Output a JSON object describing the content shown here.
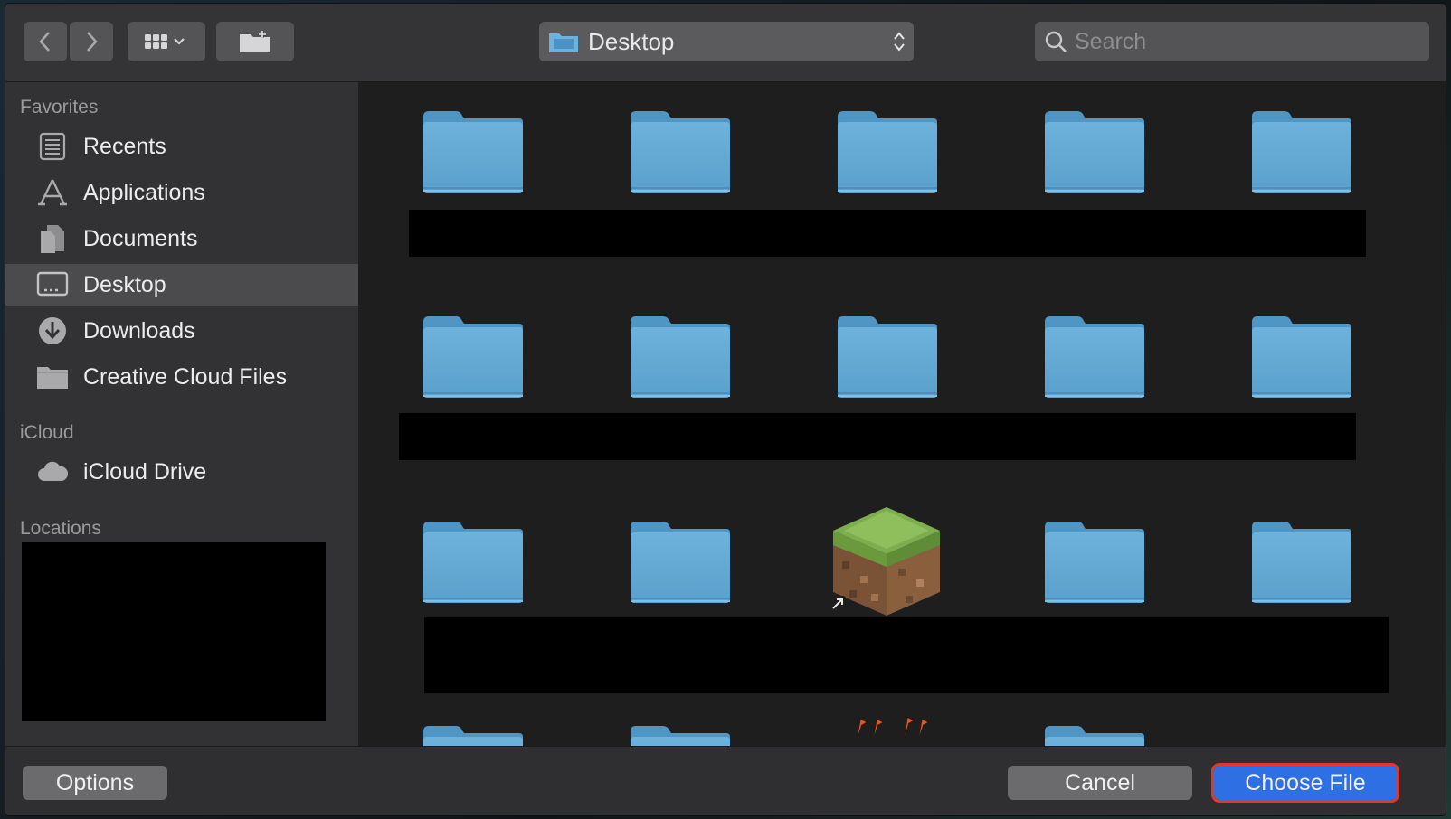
{
  "toolbar": {
    "path_label": "Desktop",
    "search_placeholder": "Search"
  },
  "sidebar": {
    "favorites_title": "Favorites",
    "favorites": [
      {
        "label": "Recents",
        "icon": "recents-icon"
      },
      {
        "label": "Applications",
        "icon": "applications-icon"
      },
      {
        "label": "Documents",
        "icon": "documents-icon"
      },
      {
        "label": "Desktop",
        "icon": "desktop-icon",
        "selected": true
      },
      {
        "label": "Downloads",
        "icon": "downloads-icon"
      },
      {
        "label": "Creative Cloud Files",
        "icon": "folder-icon"
      }
    ],
    "icloud_title": "iCloud",
    "icloud": [
      {
        "label": "iCloud Drive",
        "icon": "cloud-icon"
      }
    ],
    "locations_title": "Locations"
  },
  "content": {
    "items": [
      {
        "type": "folder-icon"
      },
      {
        "type": "folder-icon"
      },
      {
        "type": "folder-icon"
      },
      {
        "type": "folder-icon"
      },
      {
        "type": "folder-icon"
      },
      {
        "type": "folder-icon"
      },
      {
        "type": "folder-icon"
      },
      {
        "type": "folder-icon"
      },
      {
        "type": "folder-icon"
      },
      {
        "type": "folder-icon"
      },
      {
        "type": "folder-icon"
      },
      {
        "type": "folder-icon"
      },
      {
        "type": "minecraft-alias-icon"
      },
      {
        "type": "folder-icon"
      },
      {
        "type": "folder-icon"
      }
    ]
  },
  "buttons": {
    "options": "Options",
    "cancel": "Cancel",
    "choose": "Choose File"
  },
  "colors": {
    "accent": "#2f6fe4",
    "highlight_outline": "#e0392b",
    "folder": "#6cb2dc"
  }
}
